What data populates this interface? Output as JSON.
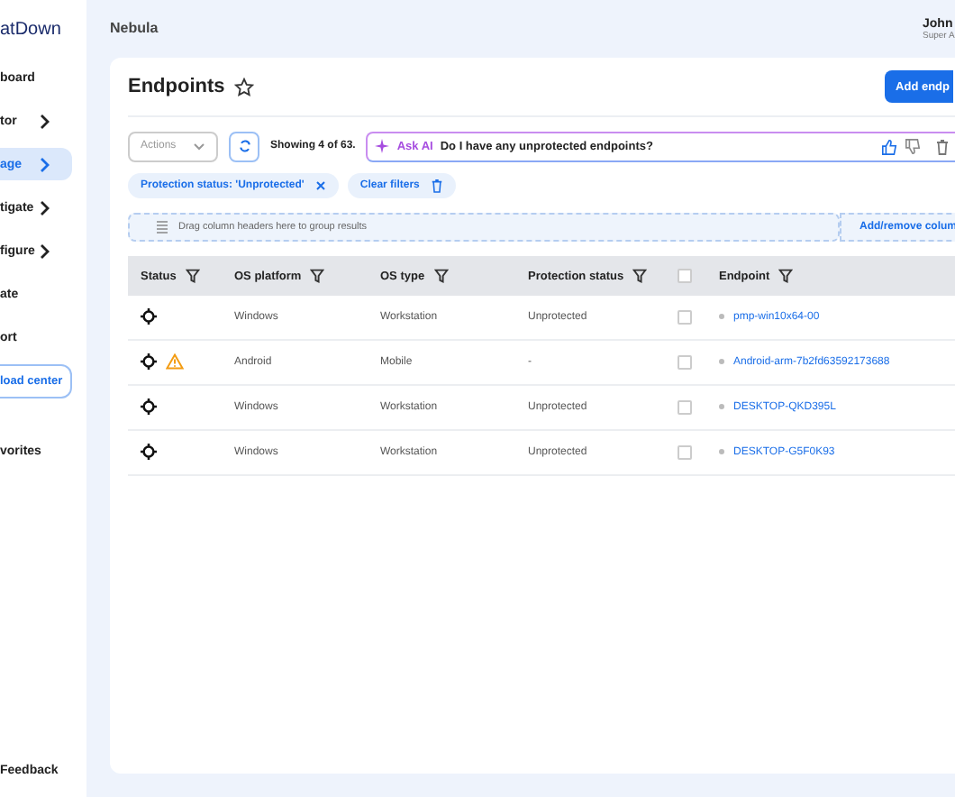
{
  "sidebar": {
    "logo": "atDown",
    "items": [
      {
        "label": "board",
        "selected": false,
        "has_chevron": false
      },
      {
        "label": "tor",
        "selected": false,
        "has_chevron": true
      },
      {
        "label": "age",
        "selected": true,
        "has_chevron": true
      },
      {
        "label": "tigate",
        "selected": false,
        "has_chevron": true
      },
      {
        "label": "figure",
        "selected": false,
        "has_chevron": true
      },
      {
        "label": "ate",
        "selected": false,
        "has_chevron": false
      },
      {
        "label": "ort",
        "selected": false,
        "has_chevron": false
      }
    ],
    "download_button": "load center",
    "favorites": "vorites",
    "feedback": "Feedback"
  },
  "header": {
    "title": "Nebula",
    "user_name": "John",
    "user_role": "Super A"
  },
  "page": {
    "title": "Endpoints",
    "favorite": false,
    "add_button": "Add endp"
  },
  "toolbar": {
    "actions": "Actions",
    "count": "Showing 4 of 63.",
    "ask_ai_label": "Ask AI",
    "ask_ai_query": "Do I have any unprotected endpoints?"
  },
  "filters": [
    {
      "label": "Protection status: 'Unprotected'",
      "kind": "filter"
    },
    {
      "label": "Clear filters",
      "kind": "clear"
    }
  ],
  "group_bar": {
    "placeholder": "Drag column headers here to group results",
    "columns_button": "Add/remove colum"
  },
  "table": {
    "all_selected": false,
    "columns": [
      "Status",
      "OS platform",
      "OS type",
      "Protection status",
      "",
      "Endpoint"
    ],
    "rows": [
      {
        "warning": false,
        "os_platform": "Windows",
        "os_type": "Workstation",
        "protection_status": "Unprotected",
        "checked": false,
        "endpoint": "pmp-win10x64-00"
      },
      {
        "warning": true,
        "os_platform": "Android",
        "os_type": "Mobile",
        "protection_status": "-",
        "checked": false,
        "endpoint": "Android-arm-7b2fd63592173688"
      },
      {
        "warning": false,
        "os_platform": "Windows",
        "os_type": "Workstation",
        "protection_status": "Unprotected",
        "checked": false,
        "endpoint": "DESKTOP-QKD395L"
      },
      {
        "warning": false,
        "os_platform": "Windows",
        "os_type": "Workstation",
        "protection_status": "Unprotected",
        "checked": false,
        "endpoint": "DESKTOP-G5F0K93"
      }
    ]
  }
}
